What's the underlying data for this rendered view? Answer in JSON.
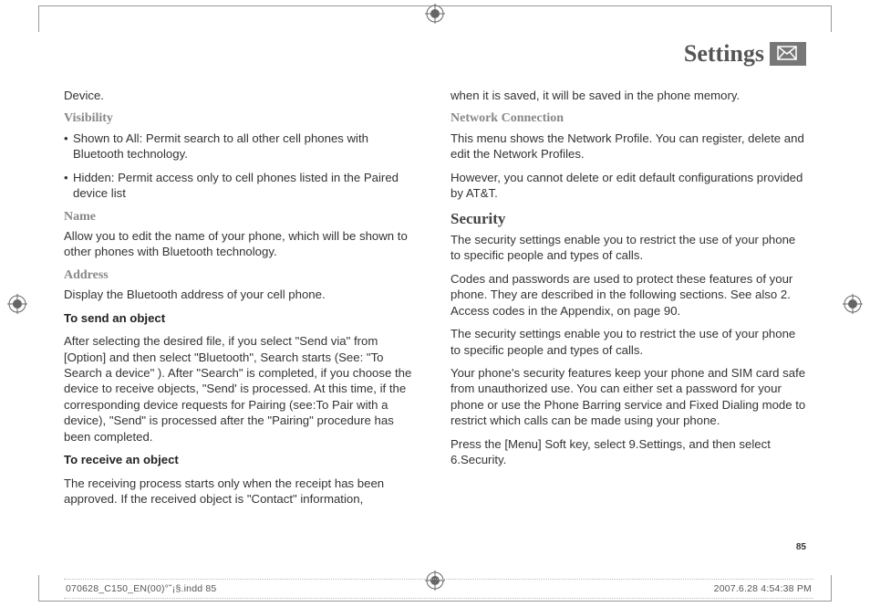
{
  "header": {
    "title": "Settings"
  },
  "left": {
    "device_cont": "Device.",
    "visibility": {
      "heading": "Visibility",
      "b1": "Shown to All: Permit search to all other cell phones with Bluetooth technology.",
      "b2": "Hidden: Permit access only to cell phones listed in the Paired device list"
    },
    "name": {
      "heading": "Name",
      "p": "Allow you to edit the name of your phone, which will be shown to other phones with Bluetooth technology."
    },
    "address": {
      "heading": "Address",
      "p": "Display the Bluetooth address of your cell phone.",
      "send_h": "To send an object",
      "send_p": "After selecting the desired file, if you select \"Send via\" from [Option] and then select \"Bluetooth\", Search starts (See: \"To Search a device\" ). After \"Search\" is completed, if you choose the device to receive objects, \"Send' is processed. At this time, if the corresponding device requests for Pairing (see:To Pair with a device), \"Send\" is processed after the \"Pairing\" procedure has been completed.",
      "recv_h": "To receive an object",
      "recv_p": "The receiving process starts only when the receipt has been approved. If the received object is \"Contact\" information,"
    }
  },
  "right": {
    "cont": "when it is saved, it will be saved in the phone memory.",
    "net": {
      "heading": "Network Connection",
      "p1": "This menu shows the Network Profile. You can register, delete and edit the Network Profiles.",
      "p2": "However, you cannot delete or edit default configurations provided by AT&T."
    },
    "security": {
      "heading": "Security",
      "p1": "The security settings enable you to restrict the use of your phone to specific people and types of calls.",
      "p2": "Codes and passwords are used to protect these features of your phone. They are described in the following sections. See also 2. Access codes in the Appendix, on page 90.",
      "p3": "The security settings enable you to restrict the use of your phone to specific people and types of calls.",
      "p4": "Your phone's security features keep your phone and SIM card safe from unauthorized use. You can either set a password for your phone or use the Phone Barring service and Fixed Dialing mode to restrict which calls can be made using your phone.",
      "p5": "Press the [Menu] Soft key, select 9.Settings, and then select 6.Security."
    }
  },
  "page_number": "85",
  "footer": {
    "left": "070628_C150_EN(00)°˘¡§.indd   85",
    "right": "2007.6.28   4:54:38 PM"
  }
}
